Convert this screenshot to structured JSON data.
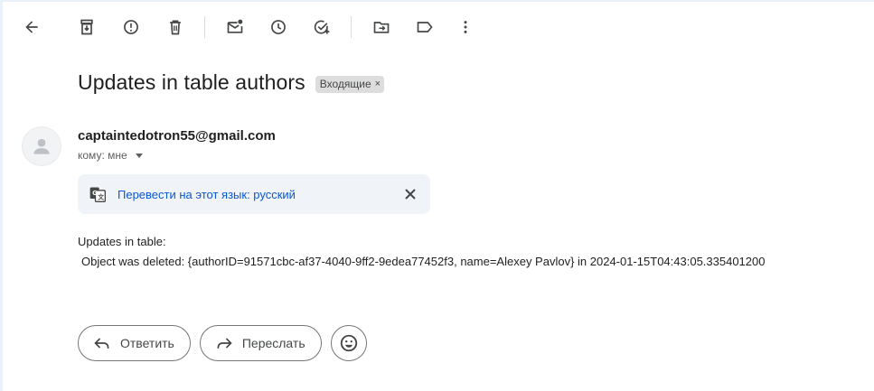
{
  "toolbar": {
    "icons": [
      "back-arrow-icon",
      "archive-icon",
      "report-spam-icon",
      "delete-icon",
      "mark-unread-icon",
      "snooze-icon",
      "add-to-tasks-icon",
      "move-to-icon",
      "label-icon",
      "more-vert-icon"
    ]
  },
  "email": {
    "subject": "Updates in table authors",
    "label_chip": "Входящие",
    "chip_close": "×",
    "sender": "captaintedotron55@gmail.com",
    "to_line": "кому: мне",
    "translate_link": "Перевести на этот язык: русский",
    "body_line1": "Updates in table:",
    "body_line2": "Object was deleted: {authorID=91571cbc-af37-4040-9ff2-9edea77452f3, name=Alexey Pavlov} in 2024-01-15T04:43:05.335401200"
  },
  "actions": {
    "reply_label": "Ответить",
    "forward_label": "Переслать"
  },
  "colors": {
    "accent_link": "#0b57d0",
    "translate_bg": "#f0f4f9",
    "chip_bg": "#dddddd",
    "icon": "#444746"
  }
}
